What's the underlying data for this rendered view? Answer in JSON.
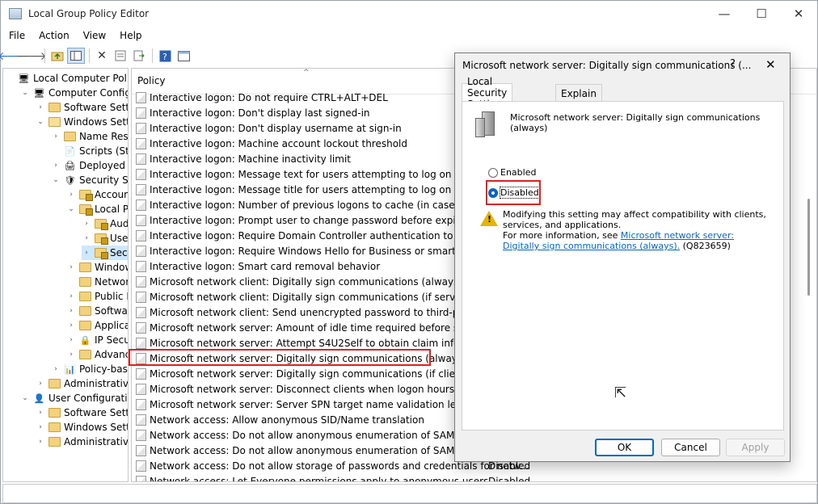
{
  "window": {
    "title": "Local Group Policy Editor",
    "minimize": "—",
    "maximize": "☐",
    "close": "✕"
  },
  "menu": [
    "File",
    "Action",
    "View",
    "Help"
  ],
  "tree": [
    {
      "label": "Local Computer Policy",
      "depth": 0,
      "exp": "",
      "icon": "computer-icon"
    },
    {
      "label": "Computer Configura",
      "depth": 1,
      "exp": "v",
      "icon": "computer-icon"
    },
    {
      "label": "Software Settings",
      "depth": 2,
      "exp": ">",
      "icon": "folder-icon"
    },
    {
      "label": "Windows Settings",
      "depth": 2,
      "exp": "v",
      "icon": "folder-icon"
    },
    {
      "label": "Name Resolu",
      "depth": 3,
      "exp": ">",
      "icon": "folder-icon"
    },
    {
      "label": "Scripts (Startu",
      "depth": 3,
      "exp": "",
      "icon": "script-icon"
    },
    {
      "label": "Deployed Prir",
      "depth": 3,
      "exp": ">",
      "icon": "printer-icon"
    },
    {
      "label": "Security Setti",
      "depth": 3,
      "exp": "v",
      "icon": "security-icon"
    },
    {
      "label": "Account P",
      "depth": 4,
      "exp": ">",
      "icon": "lock-folder-icon"
    },
    {
      "label": "Local Poli",
      "depth": 4,
      "exp": "v",
      "icon": "lock-folder-icon"
    },
    {
      "label": "Audit",
      "depth": 5,
      "exp": ">",
      "icon": "lock-folder-icon"
    },
    {
      "label": "User R",
      "depth": 5,
      "exp": ">",
      "icon": "lock-folder-icon"
    },
    {
      "label": "Securi",
      "depth": 5,
      "exp": ">",
      "icon": "lock-folder-icon",
      "selected": true
    },
    {
      "label": "Windows",
      "depth": 4,
      "exp": ">",
      "icon": "folder-icon"
    },
    {
      "label": "Network L",
      "depth": 4,
      "exp": "",
      "icon": "folder-icon"
    },
    {
      "label": "Public Key",
      "depth": 4,
      "exp": ">",
      "icon": "folder-icon"
    },
    {
      "label": "Software F",
      "depth": 4,
      "exp": ">",
      "icon": "folder-icon"
    },
    {
      "label": "Applicatio",
      "depth": 4,
      "exp": ">",
      "icon": "folder-icon"
    },
    {
      "label": "IP Security",
      "depth": 4,
      "exp": ">",
      "icon": "ip-security-icon"
    },
    {
      "label": "Advanced",
      "depth": 4,
      "exp": ">",
      "icon": "folder-icon"
    },
    {
      "label": "Policy-based",
      "depth": 3,
      "exp": ">",
      "icon": "chart-icon"
    },
    {
      "label": "Administrative Te",
      "depth": 2,
      "exp": ">",
      "icon": "folder-icon"
    },
    {
      "label": "User Configuration",
      "depth": 1,
      "exp": "v",
      "icon": "user-icon"
    },
    {
      "label": "Software Settings",
      "depth": 2,
      "exp": ">",
      "icon": "folder-icon"
    },
    {
      "label": "Windows Setting",
      "depth": 2,
      "exp": ">",
      "icon": "folder-icon"
    },
    {
      "label": "Administrative Te",
      "depth": 2,
      "exp": ">",
      "icon": "folder-icon"
    }
  ],
  "list": {
    "header": "Policy",
    "rows": [
      {
        "text": "Interactive logon: Do not require CTRL+ALT+DEL",
        "setting": ""
      },
      {
        "text": "Interactive logon: Don't display last signed-in",
        "setting": ""
      },
      {
        "text": "Interactive logon: Don't display username at sign-in",
        "setting": ""
      },
      {
        "text": "Interactive logon: Machine account lockout threshold",
        "setting": ""
      },
      {
        "text": "Interactive logon: Machine inactivity limit",
        "setting": ""
      },
      {
        "text": "Interactive logon: Message text for users attempting to log on",
        "setting": ""
      },
      {
        "text": "Interactive logon: Message title for users attempting to log on",
        "setting": ""
      },
      {
        "text": "Interactive logon: Number of previous logons to cache (in case domain",
        "setting": ""
      },
      {
        "text": "Interactive logon: Prompt user to change password before expiration",
        "setting": ""
      },
      {
        "text": "Interactive logon: Require Domain Controller authentication to unlock w",
        "setting": ""
      },
      {
        "text": "Interactive logon: Require Windows Hello for Business or smart card",
        "setting": ""
      },
      {
        "text": "Interactive logon: Smart card removal behavior",
        "setting": ""
      },
      {
        "text": "Microsoft network client: Digitally sign communications (always)",
        "setting": ""
      },
      {
        "text": "Microsoft network client: Digitally sign communications (if server agrees",
        "setting": ""
      },
      {
        "text": "Microsoft network client: Send unencrypted password to third-party SM",
        "setting": ""
      },
      {
        "text": "Microsoft network server: Amount of idle time required before suspendi",
        "setting": ""
      },
      {
        "text": "Microsoft network server: Attempt S4U2Self to obtain claim information",
        "setting": ""
      },
      {
        "text": "Microsoft network server: Digitally sign communications (always)",
        "setting": ""
      },
      {
        "text": "Microsoft network server: Digitally sign communications (if client agrees",
        "setting": ""
      },
      {
        "text": "Microsoft network server: Disconnect clients when logon hours expire",
        "setting": ""
      },
      {
        "text": "Microsoft network server: Server SPN target name validation level",
        "setting": ""
      },
      {
        "text": "Network access: Allow anonymous SID/Name translation",
        "setting": ""
      },
      {
        "text": "Network access: Do not allow anonymous enumeration of SAM account",
        "setting": ""
      },
      {
        "text": "Network access: Do not allow anonymous enumeration of SAM account",
        "setting": ""
      },
      {
        "text": "Network access: Do not allow storage of passwords and credentials for netw...",
        "setting": "Disabled"
      },
      {
        "text": "Network access: Let Everyone permissions apply to anonymous users",
        "setting": "Disabled"
      }
    ]
  },
  "dialog": {
    "title": "Microsoft network server: Digitally sign communications (...",
    "help": "?",
    "close": "✕",
    "tabs": [
      "Local Security Setting",
      "Explain"
    ],
    "policy_name": "Microsoft network server: Digitally sign communications (always)",
    "enabled_label": "Enabled",
    "disabled_label": "Disabled",
    "selected": "Disabled",
    "warning_line1": "Modifying this setting may affect compatibility with clients, services, and applications.",
    "warning_prefix": "For more information, see ",
    "warning_link": "Microsoft network server: Digitally sign communications (always).",
    "warning_suffix": " (Q823659)",
    "ok": "OK",
    "cancel": "Cancel",
    "apply": "Apply"
  },
  "colors": {
    "highlight": "#d9241c",
    "accent": "#0067c0",
    "link": "#0066cc"
  }
}
